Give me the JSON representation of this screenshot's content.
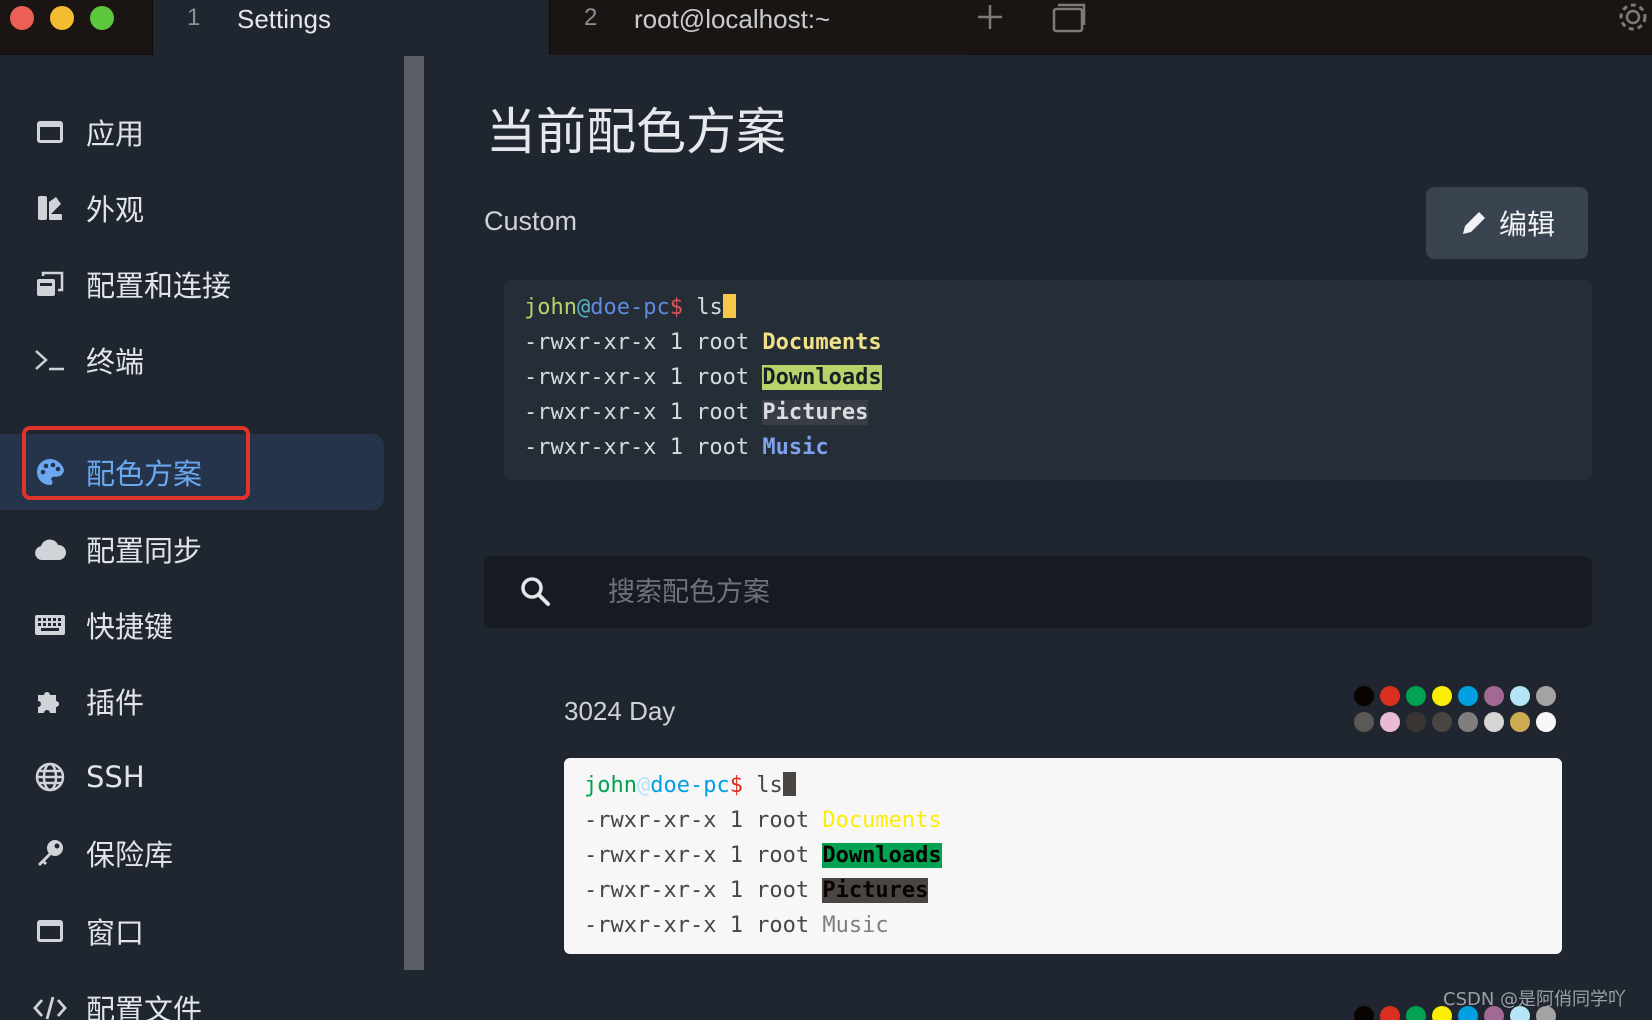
{
  "tabs": [
    {
      "num": "1",
      "label": "Settings"
    },
    {
      "num": "2",
      "label": "root@localhost:~"
    }
  ],
  "sidebar": {
    "items": [
      {
        "label": "应用",
        "icon": "window-icon"
      },
      {
        "label": "外观",
        "icon": "appearance-icon"
      },
      {
        "label": "配置和连接",
        "icon": "profiles-icon"
      },
      {
        "label": "终端",
        "icon": "terminal-icon"
      },
      {
        "label": "配色方案",
        "icon": "palette-icon",
        "active": true
      },
      {
        "label": "配置同步",
        "icon": "cloud-icon"
      },
      {
        "label": "快捷键",
        "icon": "keyboard-icon"
      },
      {
        "label": "插件",
        "icon": "puzzle-icon"
      },
      {
        "label": "SSH",
        "icon": "globe-icon"
      },
      {
        "label": "保险库",
        "icon": "key-icon"
      },
      {
        "label": "窗口",
        "icon": "window-icon"
      },
      {
        "label": "配置文件",
        "icon": "code-icon"
      }
    ]
  },
  "main": {
    "title": "当前配色方案",
    "scheme_name": "Custom",
    "edit_label": "编辑",
    "search_placeholder": "搜索配色方案",
    "preview": {
      "user": "john",
      "at": "@",
      "host": "doe-pc",
      "prompt": "$",
      "command": " ls",
      "perm": "-rwxr-xr-x 1 root ",
      "files": [
        "Documents",
        "Downloads",
        "Pictures",
        "Music"
      ]
    },
    "schemes": [
      {
        "name": "3024 Day",
        "colors": [
          "#090300",
          "#db2d20",
          "#01a252",
          "#fded02",
          "#01a0e4",
          "#a16a94",
          "#b5e4f4",
          "#a5a2a2",
          "#5c5855",
          "#e8bbd0",
          "#3a3432",
          "#4a4543",
          "#807d7c",
          "#d6d5d4",
          "#cdab53",
          "#f7f7f7"
        ]
      }
    ]
  },
  "watermark": "CSDN @是阿俏同学吖",
  "colors": {
    "accent": "#6aa8ef",
    "highlight_border": "#e0342b",
    "background": "#1f2630"
  }
}
